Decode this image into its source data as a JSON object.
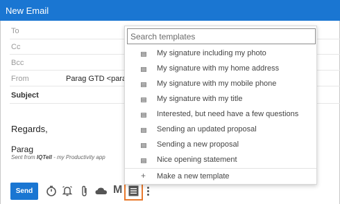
{
  "window": {
    "title": "New Email"
  },
  "fields": {
    "to_label": "To",
    "cc_label": "Cc",
    "bcc_label": "Bcc",
    "from_label": "From",
    "from_value": "Parag GTD <parag",
    "subject_label": "Subject"
  },
  "body": {
    "greeting": "Regards,",
    "signature_name": "Parag",
    "signature_prefix": "Sent from ",
    "signature_app": "IQTell",
    "signature_suffix": " - my Productivity app"
  },
  "toolbar": {
    "send_label": "Send",
    "m_label": "M",
    "icons": [
      "timer-icon",
      "reminder-bell-icon",
      "attachment-icon",
      "cloud-icon",
      "m-logo-icon",
      "templates-icon",
      "more-vertical-icon"
    ]
  },
  "templates": {
    "search_placeholder": "Search templates",
    "items": [
      "My signature including my photo",
      "My signature with my home address",
      "My signature with my mobile phone",
      "My signature with my title",
      "Interested, but need have a few questions",
      "Sending an updated proposal",
      "Sending a new proposal",
      "Nice opening statement"
    ],
    "new_template_icon": "+",
    "new_template_label": "Make a new template"
  },
  "colors": {
    "titlebar": "#1a76d2",
    "send_button": "#1a76d2",
    "highlight": "#e8782c"
  }
}
